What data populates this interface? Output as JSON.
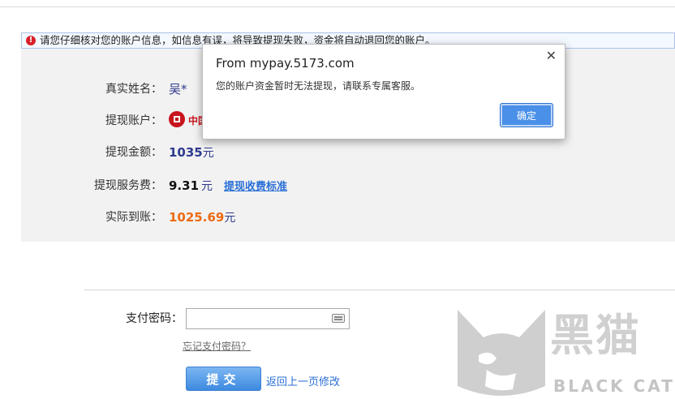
{
  "warning": {
    "text": "请您仔细核对您的账户信息，如信息有误，将导致提现失败，资金将自动退回您的账户。"
  },
  "form": {
    "name_label": "真实姓名：",
    "name_value": "吴*",
    "account_label": "提现账户：",
    "account_bank": "中国",
    "amount_label": "提现金额：",
    "amount_value": "1035",
    "amount_unit": "元",
    "fee_label": "提现服务费：",
    "fee_value": "9.31",
    "fee_unit": "元",
    "fee_link": "提现收费标准",
    "actual_label": "实际到账：",
    "actual_value": "1025.69",
    "actual_unit": "元"
  },
  "payment": {
    "password_label": "支付密码：",
    "password_placeholder": "",
    "forgot_link": "忘记支付密码？",
    "submit_label": "提交",
    "back_link": "返回上一页修改"
  },
  "dialog": {
    "title": "From mypay.5173.com",
    "message": "您的账户资金暂时无法提现，请联系专属客服。",
    "ok_label": "确定",
    "close_glyph": "✕"
  },
  "watermark": {
    "cn": "黑猫",
    "en": "BLACK CAT"
  }
}
